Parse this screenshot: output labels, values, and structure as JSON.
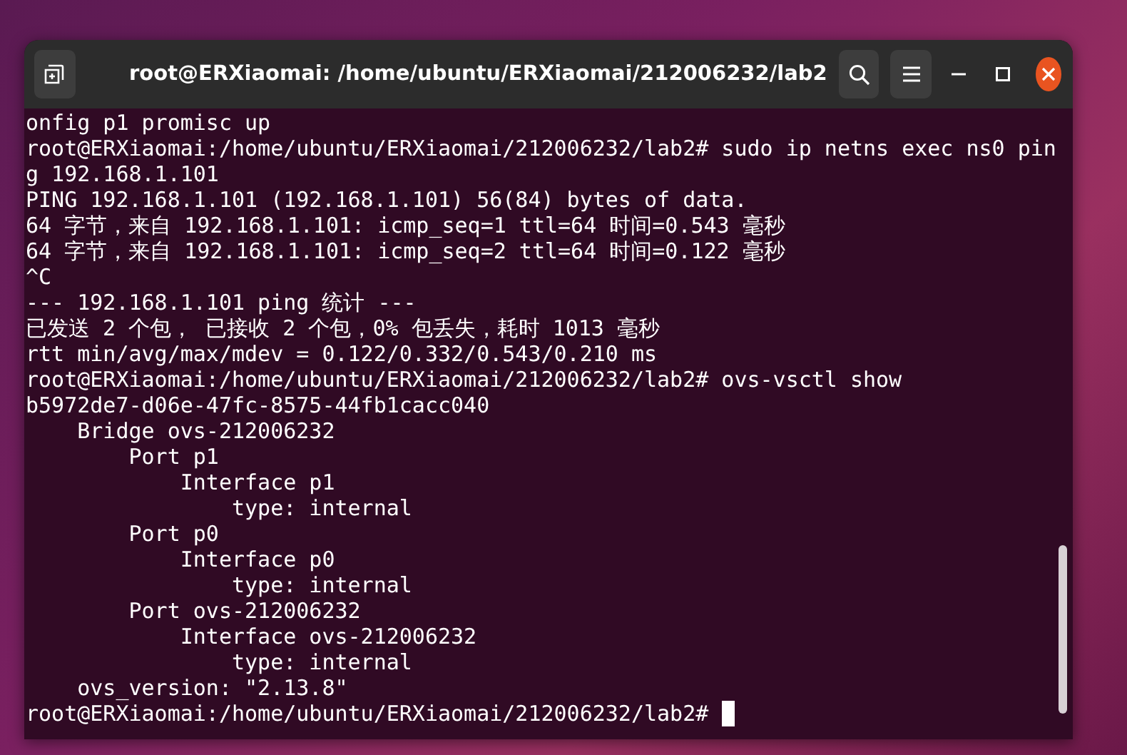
{
  "window": {
    "title": "root@ERXiaomai: /home/ubuntu/ERXiaomai/212006232/lab2"
  },
  "terminal": {
    "cursor_visible": true,
    "lines": [
      "onfig p1 promisc up",
      "root@ERXiaomai:/home/ubuntu/ERXiaomai/212006232/lab2# sudo ip netns exec ns0 pin",
      "g 192.168.1.101",
      "PING 192.168.1.101 (192.168.1.101) 56(84) bytes of data.",
      "64 字节，来自 192.168.1.101: icmp_seq=1 ttl=64 时间=0.543 毫秒",
      "64 字节，来自 192.168.1.101: icmp_seq=2 ttl=64 时间=0.122 毫秒",
      "^C",
      "--- 192.168.1.101 ping 统计 ---",
      "已发送 2 个包， 已接收 2 个包，0% 包丢失，耗时 1013 毫秒",
      "rtt min/avg/max/mdev = 0.122/0.332/0.543/0.210 ms",
      "root@ERXiaomai:/home/ubuntu/ERXiaomai/212006232/lab2# ovs-vsctl show",
      "b5972de7-d06e-47fc-8575-44fb1cacc040",
      "    Bridge ovs-212006232",
      "        Port p1",
      "            Interface p1",
      "                type: internal",
      "        Port p0",
      "            Interface p0",
      "                type: internal",
      "        Port ovs-212006232",
      "            Interface ovs-212006232",
      "                type: internal",
      "    ovs_version: \"2.13.8\"",
      "root@ERXiaomai:/home/ubuntu/ERXiaomai/212006232/lab2# "
    ]
  }
}
